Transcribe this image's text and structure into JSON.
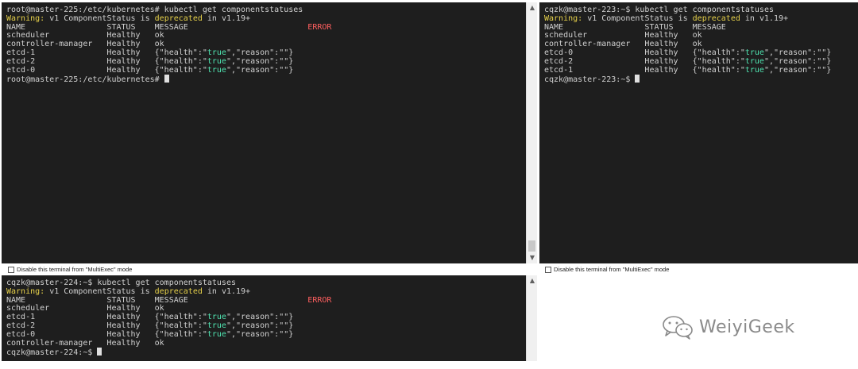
{
  "panes": [
    {
      "id": "master-225",
      "lines": [
        [
          {
            "t": "root@master-225:/etc/kubernetes# kubectl get componentstatuses",
            "c": "def"
          }
        ],
        [
          {
            "t": "Warning:",
            "c": "warn"
          },
          {
            "t": " v1 ComponentStatus is ",
            "c": "def"
          },
          {
            "t": "deprecated",
            "c": "warn"
          },
          {
            "t": " in v1.19+",
            "c": "def"
          }
        ],
        [
          {
            "t": "NAME                 STATUS    MESSAGE                         ",
            "c": "def"
          },
          {
            "t": "ERROR",
            "c": "err"
          }
        ],
        [
          {
            "t": "scheduler            Healthy   ok",
            "c": "def"
          }
        ],
        [
          {
            "t": "controller-manager   Healthy   ok",
            "c": "def"
          }
        ],
        [
          {
            "t": "etcd-1               Healthy   {\"health\":\"",
            "c": "def"
          },
          {
            "t": "true",
            "c": "str"
          },
          {
            "t": "\",\"reason\":\"\"}",
            "c": "def"
          }
        ],
        [
          {
            "t": "etcd-2               Healthy   {\"health\":\"",
            "c": "def"
          },
          {
            "t": "true",
            "c": "str"
          },
          {
            "t": "\",\"reason\":\"\"}",
            "c": "def"
          }
        ],
        [
          {
            "t": "etcd-0               Healthy   {\"health\":\"",
            "c": "def"
          },
          {
            "t": "true",
            "c": "str"
          },
          {
            "t": "\",\"reason\":\"\"}",
            "c": "def"
          }
        ],
        [
          {
            "t": "root@master-225:/etc/kubernetes# ",
            "c": "def"
          }
        ]
      ]
    },
    {
      "id": "master-223",
      "lines": [
        [
          {
            "t": "cqzk@master-223:~$ kubectl get componentstatuses",
            "c": "def"
          }
        ],
        [
          {
            "t": "Warning:",
            "c": "warn"
          },
          {
            "t": " v1 ComponentStatus is ",
            "c": "def"
          },
          {
            "t": "deprecated",
            "c": "warn"
          },
          {
            "t": " in v1.19+",
            "c": "def"
          }
        ],
        [
          {
            "t": "NAME                 STATUS    MESSAGE                                ",
            "c": "def"
          },
          {
            "t": "ERROR",
            "c": "err"
          }
        ],
        [
          {
            "t": "scheduler            Healthy   ok",
            "c": "def"
          }
        ],
        [
          {
            "t": "controller-manager   Healthy   ok",
            "c": "def"
          }
        ],
        [
          {
            "t": "etcd-0               Healthy   {\"health\":\"",
            "c": "def"
          },
          {
            "t": "true",
            "c": "str"
          },
          {
            "t": "\",\"reason\":\"\"}",
            "c": "def"
          }
        ],
        [
          {
            "t": "etcd-2               Healthy   {\"health\":\"",
            "c": "def"
          },
          {
            "t": "true",
            "c": "str"
          },
          {
            "t": "\",\"reason\":\"\"}",
            "c": "def"
          }
        ],
        [
          {
            "t": "etcd-1               Healthy   {\"health\":\"",
            "c": "def"
          },
          {
            "t": "true",
            "c": "str"
          },
          {
            "t": "\",\"reason\":\"\"}",
            "c": "def"
          }
        ],
        [
          {
            "t": "cqzk@master-223:~$ ",
            "c": "def"
          }
        ]
      ]
    },
    {
      "id": "master-224",
      "lines": [
        [
          {
            "t": "cqzk@master-224:~$ kubectl get componentstatuses",
            "c": "def"
          }
        ],
        [
          {
            "t": "Warning:",
            "c": "warn"
          },
          {
            "t": " v1 ComponentStatus is ",
            "c": "def"
          },
          {
            "t": "deprecated",
            "c": "warn"
          },
          {
            "t": " in v1.19+",
            "c": "def"
          }
        ],
        [
          {
            "t": "NAME                 STATUS    MESSAGE                         ",
            "c": "def"
          },
          {
            "t": "ERROR",
            "c": "err"
          }
        ],
        [
          {
            "t": "scheduler            Healthy   ok",
            "c": "def"
          }
        ],
        [
          {
            "t": "etcd-1               Healthy   {\"health\":\"",
            "c": "def"
          },
          {
            "t": "true",
            "c": "str"
          },
          {
            "t": "\",\"reason\":\"\"}",
            "c": "def"
          }
        ],
        [
          {
            "t": "etcd-2               Healthy   {\"health\":\"",
            "c": "def"
          },
          {
            "t": "true",
            "c": "str"
          },
          {
            "t": "\",\"reason\":\"\"}",
            "c": "def"
          }
        ],
        [
          {
            "t": "etcd-0               Healthy   {\"health\":\"",
            "c": "def"
          },
          {
            "t": "true",
            "c": "str"
          },
          {
            "t": "\",\"reason\":\"\"}",
            "c": "def"
          }
        ],
        [
          {
            "t": "controller-manager   Healthy   ok",
            "c": "def"
          }
        ],
        [
          {
            "t": "cqzk@master-224:~$ ",
            "c": "def"
          }
        ]
      ]
    }
  ],
  "multiexec_checkbox_label": "Disable this terminal from \"MultiExec\" mode",
  "watermark_text": "WeiyiGeek",
  "colors": {
    "terminal_bg": "#1e1e1e",
    "text": "#d0d0d0",
    "warning": "#e5d04a",
    "error": "#ff5f5f",
    "string": "#4fe3b0"
  },
  "icons": {
    "scroll_up": "chevron-up-icon",
    "scroll_down": "chevron-down-icon",
    "watermark_logo": "wechat-logo-icon"
  }
}
